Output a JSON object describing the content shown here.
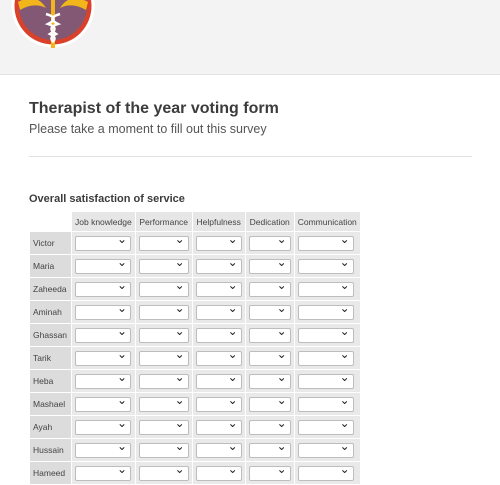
{
  "form": {
    "title": "Therapist of the year voting form",
    "subtitle": "Please take a moment to fill out this survey"
  },
  "section": {
    "title": "Overall satisfaction of service",
    "columns": [
      "Job knowledge",
      "Performance",
      "Helpfulness",
      "Dedication",
      "Communication"
    ],
    "rows": [
      "Victor",
      "Maria",
      "Zaheeda",
      "Aminah",
      "Ghassan",
      "Tarik",
      "Heba",
      "Mashael",
      "Ayah",
      "Hussain",
      "Hameed"
    ]
  },
  "icons": {
    "dropdown": "chevron-down-icon",
    "logo": "caduceus-logo"
  },
  "colors": {
    "logo_red": "#d9412b",
    "logo_gold": "#f2b51a",
    "logo_blue": "#3a6bb0"
  }
}
